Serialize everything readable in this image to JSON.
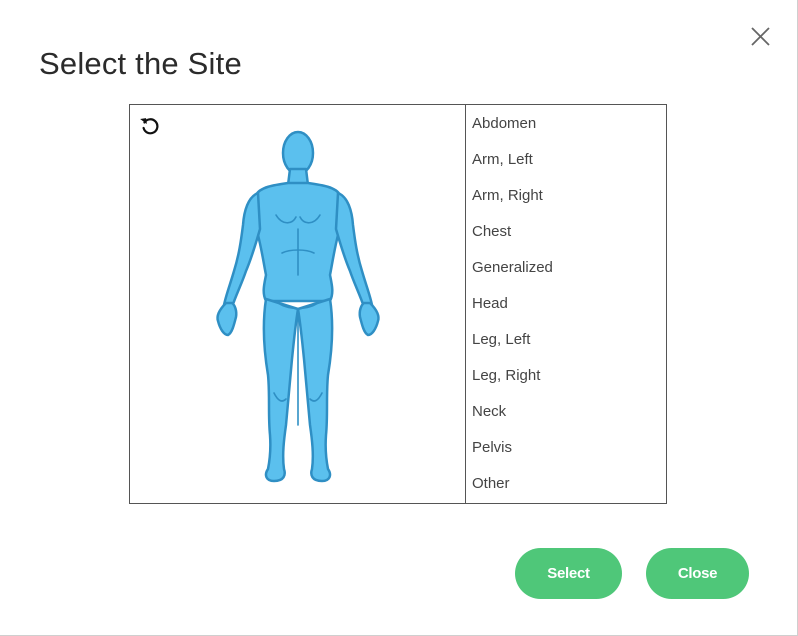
{
  "dialog": {
    "title": "Select the Site",
    "close_icon": "close-icon"
  },
  "site_picker": {
    "reset_icon": "rotate-ccw-icon",
    "figure": "human-body-front-figure",
    "figure_color": "#5bc0ee",
    "sites": [
      "Abdomen",
      "Arm, Left",
      "Arm, Right",
      "Chest",
      "Generalized",
      "Head",
      "Leg, Left",
      "Leg, Right",
      "Neck",
      "Pelvis",
      "Other"
    ]
  },
  "buttons": {
    "select_label": "Select",
    "close_label": "Close",
    "color": "#4fc779"
  }
}
